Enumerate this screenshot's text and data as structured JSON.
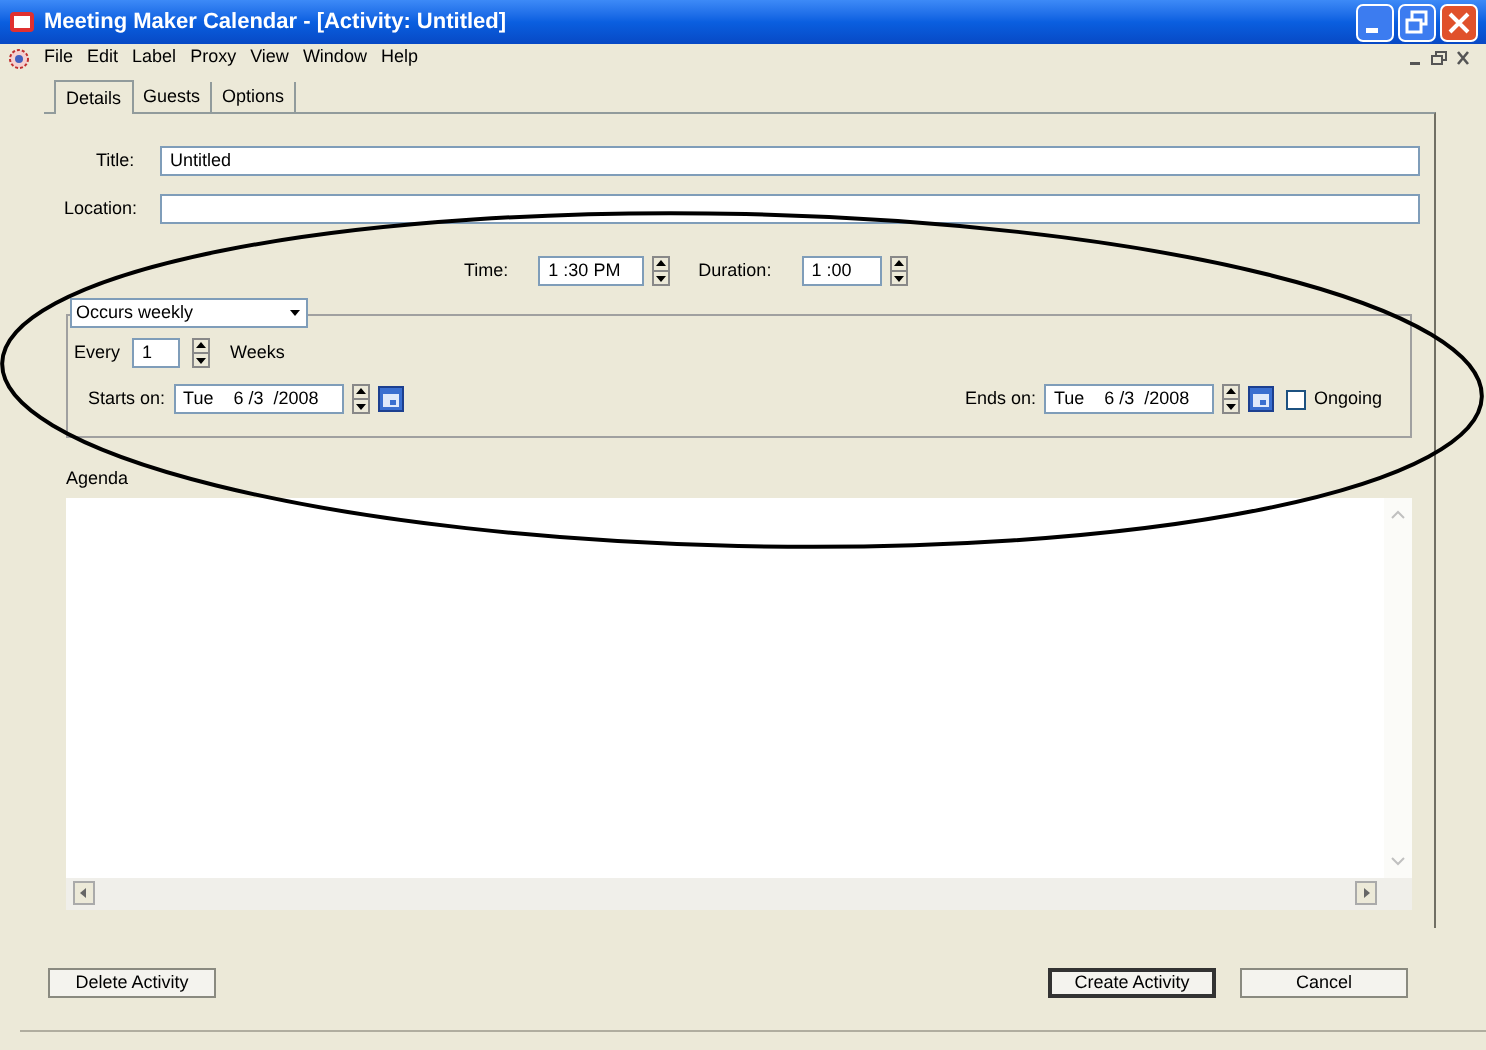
{
  "window": {
    "title": "Meeting Maker Calendar - [Activity: Untitled]"
  },
  "menu": [
    "File",
    "Edit",
    "Label",
    "Proxy",
    "View",
    "Window",
    "Help"
  ],
  "tabs": [
    {
      "label": "Details",
      "selected": true
    },
    {
      "label": "Guests",
      "selected": false
    },
    {
      "label": "Options",
      "selected": false
    }
  ],
  "title_field": {
    "label": "Title:",
    "value": "Untitled"
  },
  "location_field": {
    "label": "Location:"
  },
  "time": {
    "label": "Time:",
    "value": "1 :30 PM"
  },
  "duration": {
    "label": "Duration:",
    "value": "1 :00"
  },
  "recurrence": {
    "dropdown": "Occurs weekly",
    "every_label": "Every",
    "every_value": "1",
    "unit": "Weeks",
    "starts_label": "Starts on:",
    "starts_value": "Tue    6 /3  /2008",
    "ends_label": "Ends on:",
    "ends_value": "Tue    6 /3  /2008",
    "ongoing": {
      "label": "Ongoing",
      "checked": false
    }
  },
  "agenda": {
    "label": "Agenda"
  },
  "buttons": [
    {
      "label": "Delete Activity",
      "default": false
    },
    {
      "label": "Create Activity",
      "default": true
    },
    {
      "label": "Cancel",
      "default": false
    }
  ]
}
